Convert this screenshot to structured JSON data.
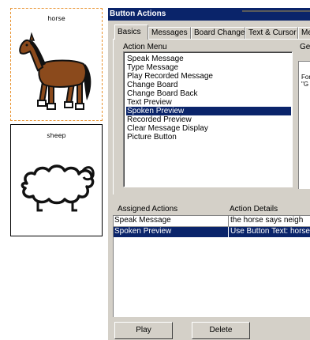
{
  "cards": {
    "horse": {
      "label": "horse"
    },
    "sheep": {
      "label": "sheep"
    }
  },
  "dialog": {
    "title": "Button Actions",
    "tabs": [
      "Basics",
      "Messages",
      "Board Change",
      "Text & Cursor",
      "Mes"
    ],
    "active_tab": "Basics",
    "action_menu_label": "Action Menu",
    "general_label": "Ger",
    "general_text": [
      "For",
      "\"G"
    ],
    "action_menu_items": [
      "Speak Message",
      "Type Message",
      "Play Recorded Message",
      "Change Board",
      "Change Board Back",
      "Text Preview",
      "Spoken Preview",
      "Recorded Preview",
      "Clear Message Display",
      "Picture Button"
    ],
    "selected_action": "Spoken Preview",
    "assigned": {
      "header_actions": "Assigned Actions",
      "header_details": "Action Details",
      "rows": [
        {
          "action": "Speak Message",
          "details": "the horse says neigh",
          "selected": false
        },
        {
          "action": "Spoken Preview",
          "details": "Use Button Text: horse",
          "selected": true
        }
      ]
    },
    "buttons": {
      "play": "Play",
      "delete": "Delete"
    }
  },
  "colors": {
    "title_bar": "#0a246a",
    "selection": "#0a246a",
    "dialog_face": "#d4d0c8",
    "selected_card_border": "#e8912d",
    "horse_body": "#8b4a1c"
  }
}
